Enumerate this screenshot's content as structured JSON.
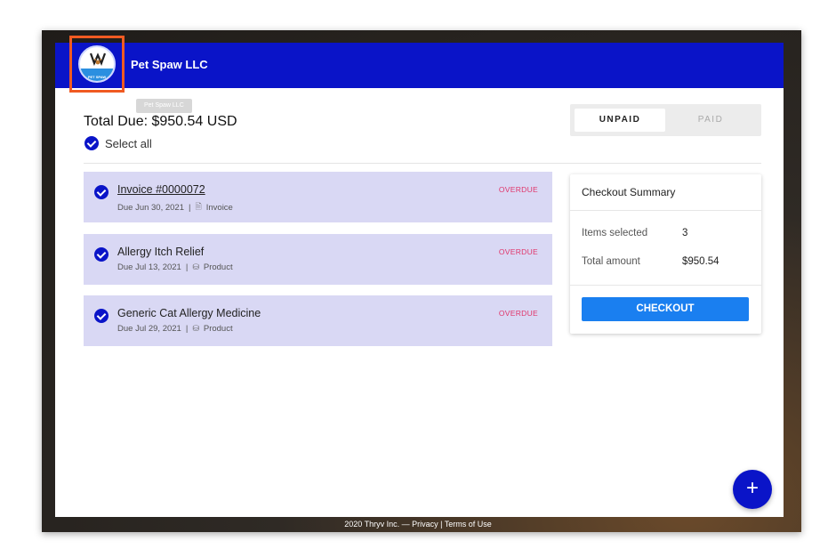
{
  "header": {
    "brand_name": "Pet Spaw LLC",
    "logo_text": "PET SPAW",
    "logo_icon": "paw-logo-icon",
    "color": "#0a14c8"
  },
  "tooltip": "Pet Spaw LLC",
  "total_due": "Total Due: $950.54 USD",
  "select_all": "Select all",
  "tabs": [
    {
      "label": "UNPAID",
      "active": true
    },
    {
      "label": "PAID",
      "active": false
    }
  ],
  "items": [
    {
      "title": "Invoice #0000072",
      "due": "Due Jun 30, 2021",
      "separator": "|",
      "type": "Invoice",
      "type_icon": "document-icon",
      "status": "OVERDUE"
    },
    {
      "title": "Allergy Itch Relief",
      "due": "Due Jul 13, 2021",
      "separator": "|",
      "type": "Product",
      "type_icon": "basket-icon",
      "status": "OVERDUE"
    },
    {
      "title": "Generic Cat Allergy Medicine",
      "due": "Due Jul 29, 2021",
      "separator": "|",
      "type": "Product",
      "type_icon": "basket-icon",
      "status": "OVERDUE"
    }
  ],
  "summary": {
    "title": "Checkout Summary",
    "items_selected_label": "Items selected",
    "items_selected_value": "3",
    "total_amount_label": "Total amount",
    "total_amount_value": "$950.54",
    "checkout_label": "CHECKOUT"
  },
  "fab_label": "+",
  "footer": "2020 Thryv Inc. — Privacy | Terms of Use"
}
